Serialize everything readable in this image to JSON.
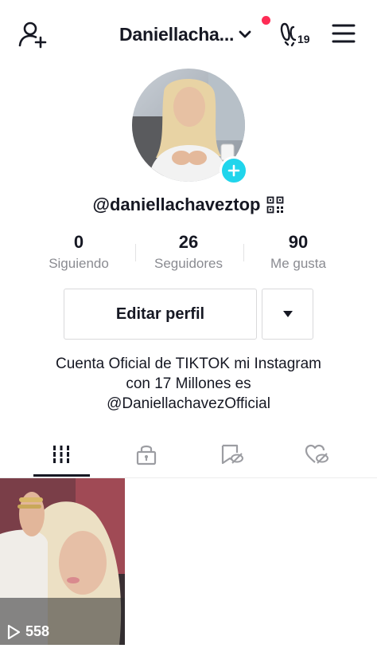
{
  "header": {
    "username_title": "Daniellacha...",
    "footprint_count": "19",
    "add_friend_icon": "person-add-icon",
    "dropdown_icon": "chevron-down-icon",
    "footprint_icon": "footprints-icon",
    "menu_icon": "hamburger-menu-icon",
    "notification_dot_color": "#fe2c55"
  },
  "profile": {
    "avatar_alt": "profile-photo",
    "add_icon": "plus-icon",
    "add_color": "#20d5ec",
    "handle": "@daniellachaveztop",
    "qr_icon": "qr-code-icon"
  },
  "stats": [
    {
      "value": "0",
      "label": "Siguiendo"
    },
    {
      "value": "26",
      "label": "Seguidores"
    },
    {
      "value": "90",
      "label": "Me gusta"
    }
  ],
  "actions": {
    "edit_label": "Editar perfil",
    "dropdown_icon": "caret-down-icon"
  },
  "bio": {
    "line1": "Cuenta Oficial de TIKTOK mi Instagram",
    "line2": "con 17 Millones es",
    "line3": "@DaniellachavezOfficial"
  },
  "tabs": [
    {
      "icon": "grid-icon",
      "active": true
    },
    {
      "icon": "lock-icon",
      "active": false
    },
    {
      "icon": "bookmark-hidden-icon",
      "active": false
    },
    {
      "icon": "heart-hidden-icon",
      "active": false
    }
  ],
  "videos": [
    {
      "views": "558",
      "play_icon": "play-outline-icon"
    }
  ]
}
